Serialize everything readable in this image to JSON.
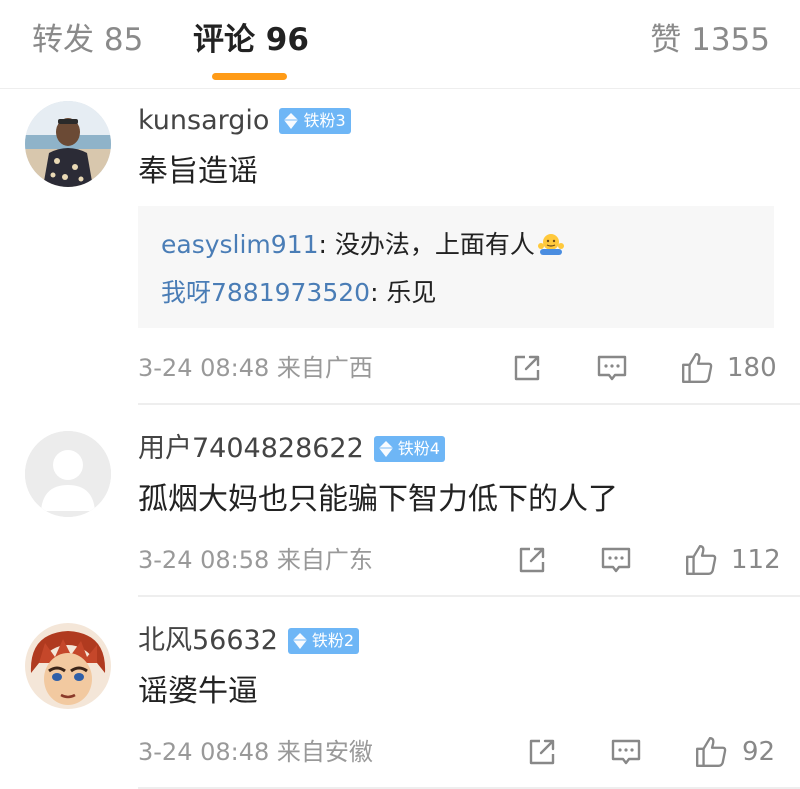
{
  "tabs": {
    "repost": "转发 85",
    "comments": "评论 96",
    "likes": "赞 1355"
  },
  "colors": {
    "accent": "#ff9b17",
    "badge": "#6eb6f6",
    "link": "#4a7db6"
  },
  "comments": [
    {
      "username": "kunsargio",
      "badge": "铁粉3",
      "text": "奉旨造谣",
      "replies": [
        {
          "user": "easyslim911",
          "text": ": 没办法，上面有人",
          "emoji": "shrug-emoji"
        },
        {
          "user": "我呀7881973520",
          "text": ": 乐见"
        }
      ],
      "meta": "3-24 08:48 来自广西",
      "likes": "180"
    },
    {
      "username": "用户7404828622",
      "badge": "铁粉4",
      "text": "孤烟大妈也只能骗下智力低下的人了",
      "meta": "3-24 08:58 来自广东",
      "likes": "112"
    },
    {
      "username": "北风56632",
      "badge": "铁粉2",
      "text": "谣婆牛逼",
      "meta": "3-24 08:48 来自安徽",
      "likes": "92"
    }
  ]
}
